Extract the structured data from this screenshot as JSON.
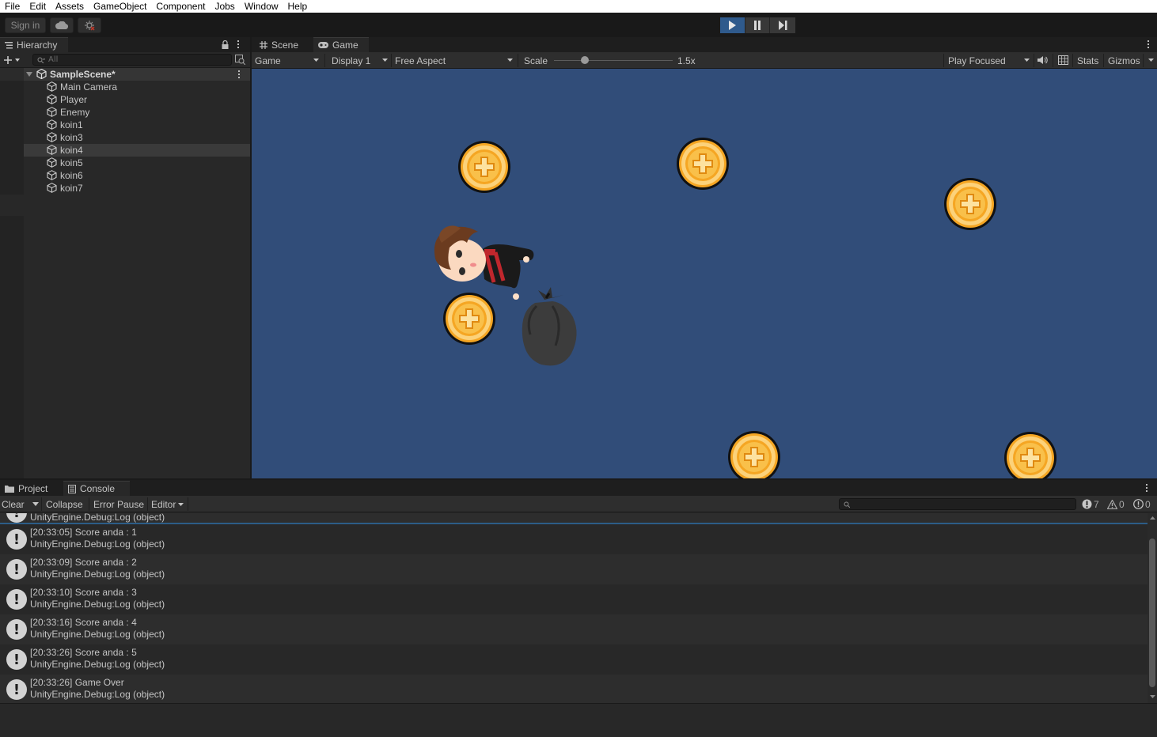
{
  "menu": [
    "File",
    "Edit",
    "Assets",
    "GameObject",
    "Component",
    "Jobs",
    "Window",
    "Help"
  ],
  "toolbar": {
    "sign_in": "Sign in",
    "cloud_icon": "cloud-icon",
    "collab_icon": "collab-icon",
    "play_icon": "play-icon",
    "pause_icon": "pause-icon",
    "step_icon": "step-icon"
  },
  "hierarchy": {
    "tab_label": "Hierarchy",
    "search_placeholder": "All",
    "scene": "SampleScene*",
    "items": [
      "Main Camera",
      "Player",
      "Enemy",
      "koin1",
      "koin3",
      "koin4",
      "koin5",
      "koin6",
      "koin7"
    ],
    "selected_index": 5
  },
  "game_view": {
    "tabs": [
      "Scene",
      "Game"
    ],
    "active_tab": "Game",
    "mode": "Game",
    "display": "Display 1",
    "aspect": "Free Aspect",
    "scale_label": "Scale",
    "scale_value": "1.5x",
    "play_focused": "Play Focused",
    "stats": "Stats",
    "gizmos": "Gizmos",
    "background_color": "#314d79"
  },
  "bottom": {
    "tabs": [
      "Project",
      "Console"
    ],
    "active_tab": "Console",
    "clear": "Clear",
    "collapse": "Collapse",
    "error_pause": "Error Pause",
    "editor": "Editor",
    "counts": {
      "log": "7",
      "warning": "0",
      "error": "0"
    },
    "partial_line": "UnityEngine.Debug:Log (object)",
    "logs": [
      {
        "msg": "[20:33:05] Score anda : 1",
        "trace": "UnityEngine.Debug:Log (object)"
      },
      {
        "msg": "[20:33:09] Score anda : 2",
        "trace": "UnityEngine.Debug:Log (object)"
      },
      {
        "msg": "[20:33:10] Score anda : 3",
        "trace": "UnityEngine.Debug:Log (object)"
      },
      {
        "msg": "[20:33:16] Score anda : 4",
        "trace": "UnityEngine.Debug:Log (object)"
      },
      {
        "msg": "[20:33:26] Score anda : 5",
        "trace": "UnityEngine.Debug:Log (object)"
      },
      {
        "msg": "[20:33:26] Game Over",
        "trace": "UnityEngine.Debug:Log (object)"
      }
    ]
  }
}
